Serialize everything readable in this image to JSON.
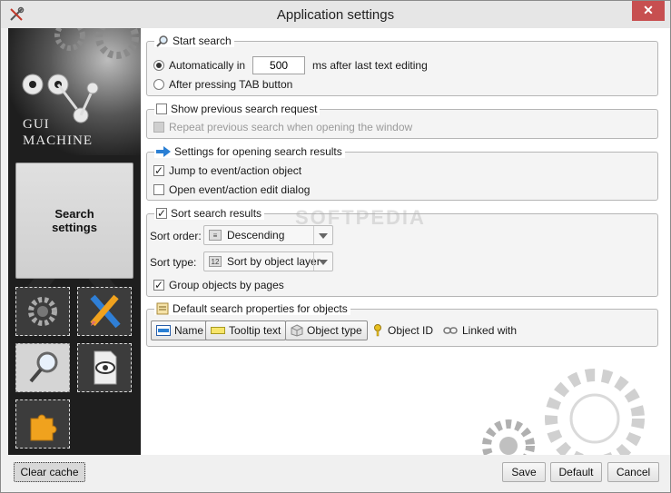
{
  "window": {
    "title": "Application settings",
    "close_glyph": "✕"
  },
  "sidebar": {
    "logo_line1": "GUI",
    "logo_line2": "MACHINE",
    "active_item": "Search settings",
    "tiles": [
      {
        "name": "general-settings",
        "icon": "gears-icon"
      },
      {
        "name": "design-settings",
        "icon": "pencil-ruler-icon"
      },
      {
        "name": "search-settings",
        "icon": "magnifier-icon",
        "active": true
      },
      {
        "name": "preview-settings",
        "icon": "document-eye-icon"
      },
      {
        "name": "plugins-settings",
        "icon": "puzzle-icon"
      }
    ]
  },
  "start_search": {
    "title": "Start search",
    "auto_label": "Automatically in",
    "auto_value": "500",
    "auto_suffix": "ms after last text editing",
    "tab_label": "After pressing TAB button",
    "selected": "auto"
  },
  "previous_request": {
    "title": "Show previous search request",
    "checked": false,
    "repeat_label": "Repeat previous search when opening the window",
    "repeat_enabled": false
  },
  "open_results": {
    "title": "Settings for opening search results",
    "jump_label": "Jump to event/action object",
    "jump_checked": true,
    "edit_label": "Open event/action edit dialog",
    "edit_checked": false
  },
  "sort_results": {
    "title": "Sort search results",
    "checked": true,
    "order_label": "Sort order:",
    "order_value": "Descending",
    "type_label": "Sort type:",
    "type_value": "Sort by object layer",
    "group_label": "Group objects by pages",
    "group_checked": true
  },
  "default_props": {
    "title": "Default search properties for objects",
    "items": [
      {
        "label": "Name",
        "pressed": true
      },
      {
        "label": "Tooltip text",
        "pressed": true
      },
      {
        "label": "Object type",
        "pressed": true
      },
      {
        "label": "Object ID",
        "pressed": false
      },
      {
        "label": "Linked with",
        "pressed": false
      }
    ]
  },
  "watermark": "SOFTPEDIA",
  "buttons": {
    "clear_cache": "Clear cache",
    "save": "Save",
    "default": "Default",
    "cancel": "Cancel"
  },
  "colors": {
    "close": "#c74f50",
    "sidebar": "#1e1e1e",
    "accent_blue": "#2a7fd4"
  }
}
